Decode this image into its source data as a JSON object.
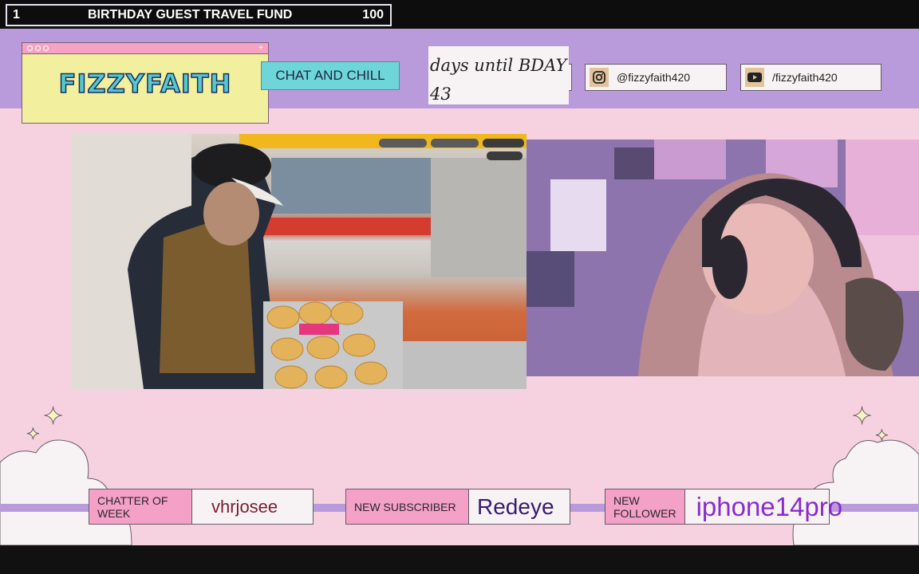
{
  "goal_bar": {
    "count": "1",
    "title": "BIRTHDAY GUEST TRAVEL FUND",
    "target": "100"
  },
  "logo": {
    "text": "FIZZYFAITH",
    "plus": "+"
  },
  "chat_button": {
    "label": "CHAT AND CHILL"
  },
  "countdown": {
    "label": "days until BDAY",
    "value": "43"
  },
  "socials": [
    {
      "icon": "instagram-icon",
      "handle": "@fizzyfaith420"
    },
    {
      "icon": "youtube-icon",
      "handle": "/fizzyfaith420"
    }
  ],
  "alerts": {
    "chatter": {
      "label": "CHATTER OF WEEK",
      "value": "vhrjosee"
    },
    "subscriber": {
      "label": "NEW SUBSCRIBER",
      "value": "Redeye"
    },
    "follower": {
      "label": "NEW FOLLOWER",
      "value": "iphone14pro"
    }
  },
  "colors": {
    "header": "#b99adb",
    "background": "#f6d2e0",
    "logo_fill": "#55c9cf",
    "chat_button": "#6ed6d9",
    "alert_label": "#f3a1c6",
    "alert_value": "#4e1b78"
  }
}
